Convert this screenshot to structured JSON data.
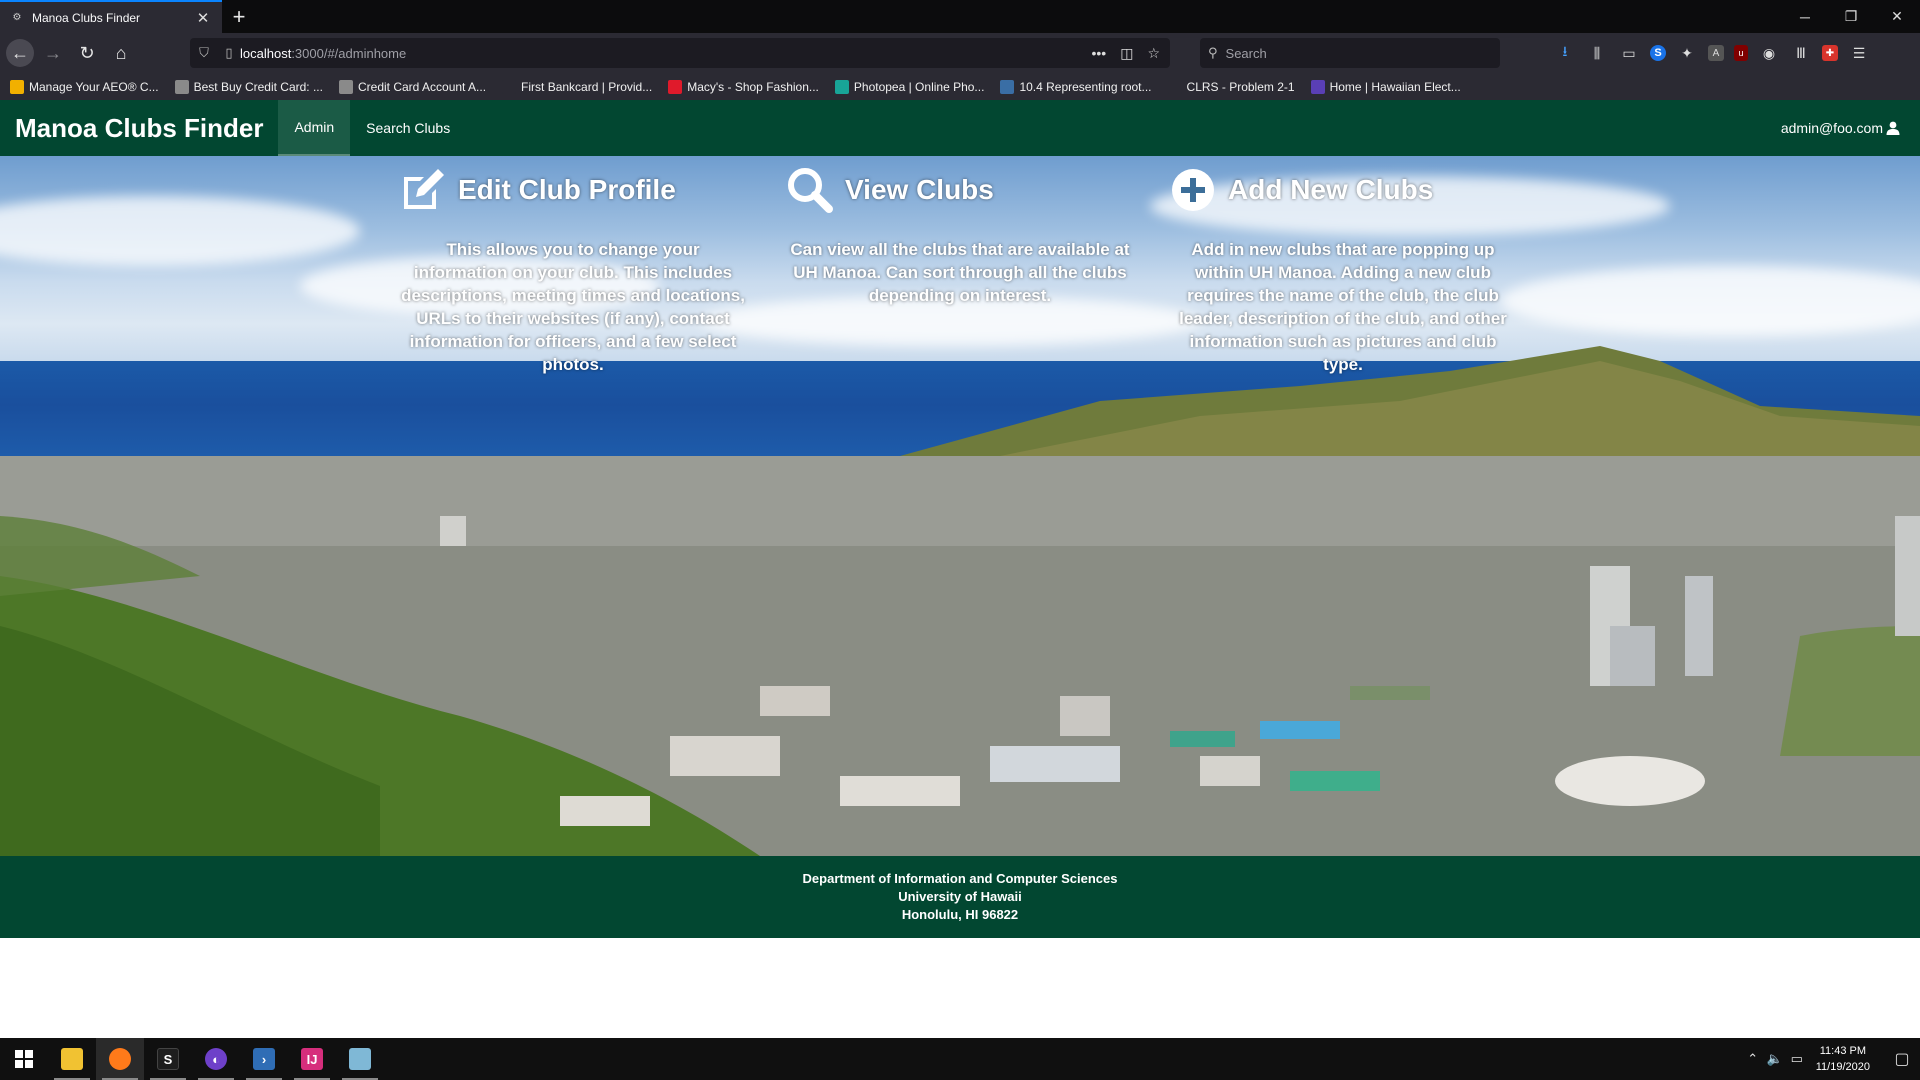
{
  "browser": {
    "tab_title": "Manoa Clubs Finder",
    "url_host": "localhost",
    "url_path": ":3000/#/adminhome",
    "search_placeholder": "Search",
    "bookmarks": [
      {
        "label": "Manage Your AEO® C...",
        "color": "#f2b000"
      },
      {
        "label": "Best Buy Credit Card: ...",
        "color": "#8a8a8a"
      },
      {
        "label": "Credit Card Account A...",
        "color": "#8a8a8a"
      },
      {
        "label": "First Bankcard | Provid...",
        "color": "#2b2a33"
      },
      {
        "label": "Macy's - Shop Fashion...",
        "color": "#e01a2b"
      },
      {
        "label": "Photopea | Online Pho...",
        "color": "#18a497"
      },
      {
        "label": "10.4 Representing root...",
        "color": "#3a6ea5"
      },
      {
        "label": "CLRS - Problem 2-1",
        "color": "#2b2a33"
      },
      {
        "label": "Home | Hawaiian Elect...",
        "color": "#5a3fb5"
      }
    ]
  },
  "app": {
    "brand": "Manoa Clubs Finder",
    "nav": {
      "admin": "Admin",
      "search": "Search Clubs"
    },
    "user": "admin@foo.com"
  },
  "features": [
    {
      "icon": "edit-icon",
      "title": "Edit Club Profile",
      "desc": "This allows you to change your information on your club. This includes descriptions, meeting times and locations, URLs to their websites (if any), contact information for officers, and a few select photos."
    },
    {
      "icon": "search-icon",
      "title": "View Clubs",
      "desc": "Can view all the clubs that are available at UH Manoa. Can sort through all the clubs depending on interest."
    },
    {
      "icon": "plus-circle-icon",
      "title": "Add New Clubs",
      "desc": "Add in new clubs that are popping up within UH Manoa. Adding a new club requires the name of the club, the club leader, description of the club, and other information such as pictures and club type."
    }
  ],
  "footer": {
    "line1": "Department of Information and Computer Sciences",
    "line2": "University of Hawaii",
    "line3": "Honolulu, HI 96822"
  },
  "taskbar": {
    "time": "11:43 PM",
    "date": "11/19/2020"
  }
}
